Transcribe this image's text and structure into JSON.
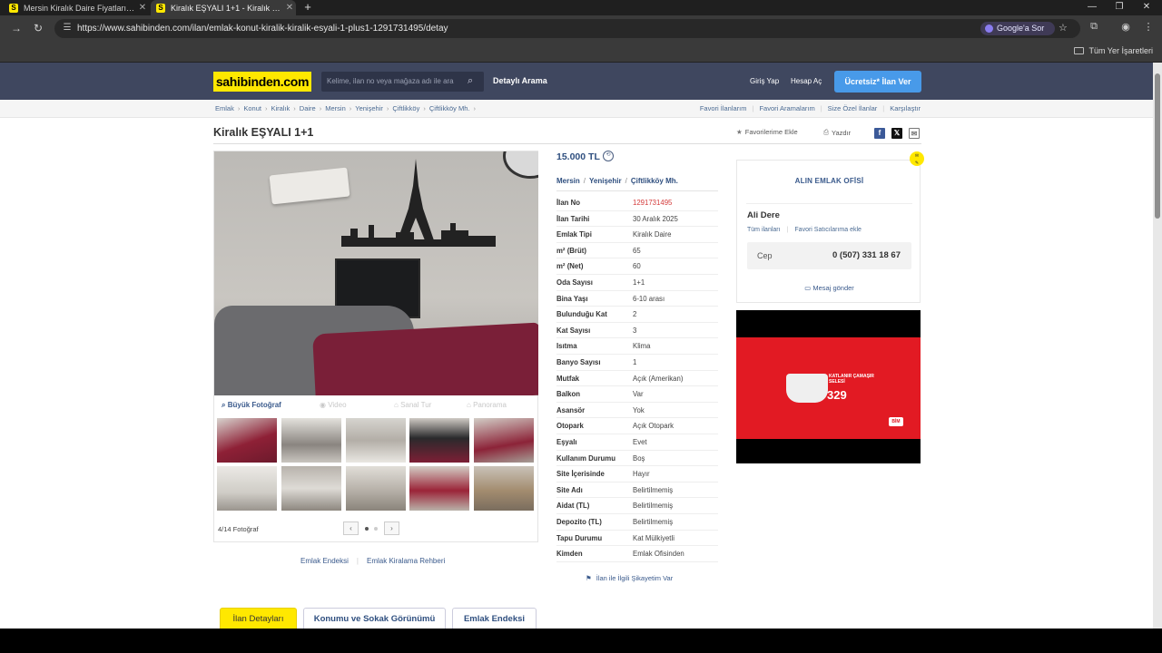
{
  "browser": {
    "tabs": [
      {
        "title": "Mersin Kiralık Daire Fiyatları ve",
        "favicon": "S",
        "active": false
      },
      {
        "title": "Kiralık EŞYALI 1+1 - Kiralık Daire",
        "favicon": "S",
        "active": true
      }
    ],
    "url": "https://www.sahibinden.com/ilan/emlak-konut-kiralik-kiralik-esyali-1-plus1-1291731495/detay",
    "google_ask": "Google'a Sor",
    "bookmarks_label": "Tüm Yer İşaretleri"
  },
  "header": {
    "logo": "sahibinden.com",
    "search_placeholder": "Kelime, ilan no veya mağaza adı ile ara",
    "advanced_search": "Detaylı Arama",
    "login": "Giriş Yap",
    "register": "Hesap Aç",
    "post_ad": "Ücretsiz* İlan Ver"
  },
  "breadcrumb": [
    "Emlak",
    "Konut",
    "Kiralık",
    "Daire",
    "Mersin",
    "Yenişehir",
    "Çiftlikköy",
    "Çiftlikköy Mh."
  ],
  "top_links": [
    "Favori İlanlarım",
    "Favori Aramalarım",
    "Size Özel İlanlar",
    "Karşılaştır"
  ],
  "listing": {
    "title": "Kiralık EŞYALI 1+1",
    "add_favorite": "Favorilerime Ekle",
    "print": "Yazdır",
    "price": "15.000 TL",
    "location": [
      "Mersin",
      "Yenişehir",
      "Çiftlikköy Mh."
    ]
  },
  "gallery": {
    "tools": [
      "Büyük Fotoğraf",
      "Video",
      "Sanal Tur",
      "Panorama"
    ],
    "photo_count": "4/14 Fotoğraf"
  },
  "details": [
    {
      "key": "İlan No",
      "value": "1291731495"
    },
    {
      "key": "İlan Tarihi",
      "value": "30 Aralık 2025"
    },
    {
      "key": "Emlak Tipi",
      "value": "Kiralık Daire"
    },
    {
      "key": "m² (Brüt)",
      "value": "65"
    },
    {
      "key": "m² (Net)",
      "value": "60"
    },
    {
      "key": "Oda Sayısı",
      "value": "1+1"
    },
    {
      "key": "Bina Yaşı",
      "value": "6-10 arası"
    },
    {
      "key": "Bulunduğu Kat",
      "value": "2"
    },
    {
      "key": "Kat Sayısı",
      "value": "3"
    },
    {
      "key": "Isıtma",
      "value": "Klima"
    },
    {
      "key": "Banyo Sayısı",
      "value": "1"
    },
    {
      "key": "Mutfak",
      "value": "Açık (Amerikan)"
    },
    {
      "key": "Balkon",
      "value": "Var"
    },
    {
      "key": "Asansör",
      "value": "Yok"
    },
    {
      "key": "Otopark",
      "value": "Açık Otopark"
    },
    {
      "key": "Eşyalı",
      "value": "Evet"
    },
    {
      "key": "Kullanım Durumu",
      "value": "Boş"
    },
    {
      "key": "Site İçerisinde",
      "value": "Hayır"
    },
    {
      "key": "Site Adı",
      "value": "Belirtilmemiş"
    },
    {
      "key": "Aidat (TL)",
      "value": "Belirtilmemiş"
    },
    {
      "key": "Depozito (TL)",
      "value": "Belirtilmemiş"
    },
    {
      "key": "Tapu Durumu",
      "value": "Kat Mülkiyetli"
    },
    {
      "key": "Kimden",
      "value": "Emlak Ofisinden"
    }
  ],
  "complain": "İlan ile İlgili Şikayetim Var",
  "seller": {
    "office": "ALIN EMLAK OFİSİ",
    "name": "Ali Dere",
    "all_ads": "Tüm ilanları",
    "add_favorite_seller": "Favori Satıcılarıma ekle",
    "phone_label": "Cep",
    "phone": "0 (507) 331 18 67",
    "message": "Mesaj gönder"
  },
  "ad": {
    "title": "KATLANIR ÇAMAŞIR SELESİ",
    "price": "329",
    "brand": "BİM"
  },
  "bottom_links": [
    "Emlak Endeksi",
    "Emlak Kiralama Rehberi"
  ],
  "page_tabs": [
    "İlan Detayları",
    "Konumu ve Sokak Görünümü",
    "Emlak Endeksi"
  ]
}
